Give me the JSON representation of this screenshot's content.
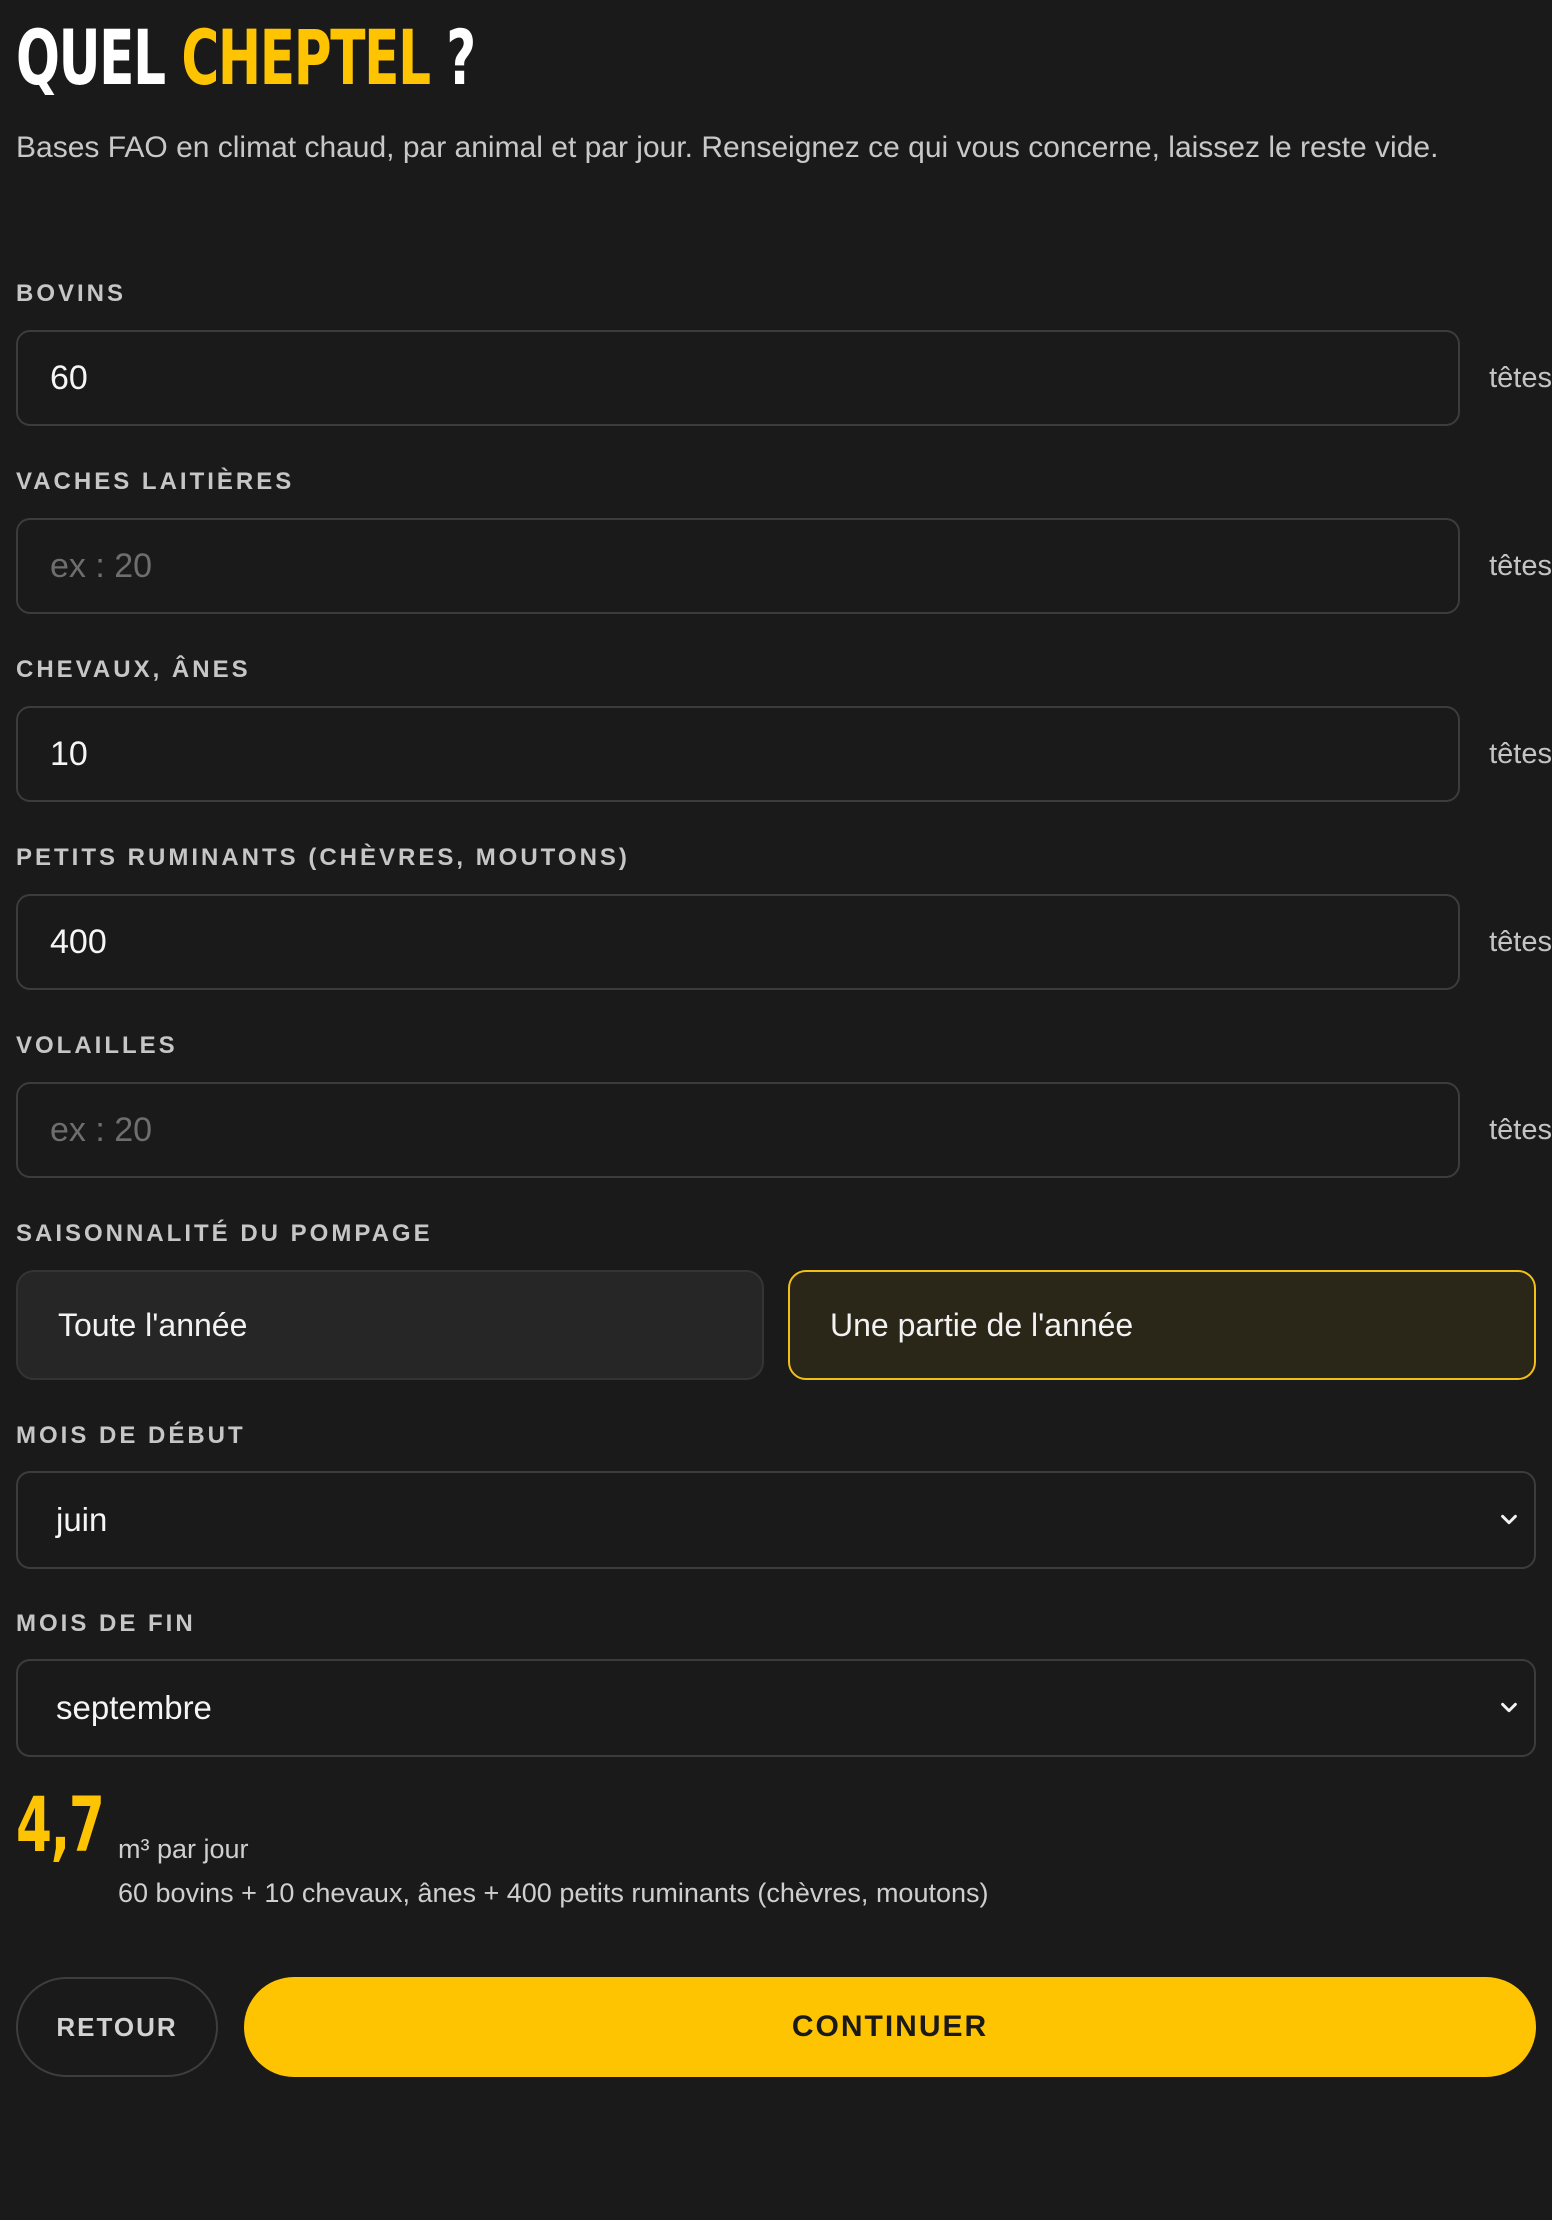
{
  "header": {
    "title_part1": "QUEL ",
    "title_accent": "CHEPTEL",
    "title_part2": " ?",
    "intro": "Bases FAO en climat chaud, par animal et par jour. Renseignez ce qui vous concerne, laissez le reste vide."
  },
  "fields": [
    {
      "label": "BOVINS",
      "value": "60",
      "placeholder": "ex : 20",
      "unit": "têtes"
    },
    {
      "label": "VACHES LAITIÈRES",
      "value": "",
      "placeholder": "ex : 20",
      "unit": "têtes"
    },
    {
      "label": "CHEVAUX, ÂNES",
      "value": "10",
      "placeholder": "ex : 20",
      "unit": "têtes"
    },
    {
      "label": "PETITS RUMINANTS (CHÈVRES, MOUTONS)",
      "value": "400",
      "placeholder": "ex : 20",
      "unit": "têtes"
    },
    {
      "label": "VOLAILLES",
      "value": "",
      "placeholder": "ex : 20",
      "unit": "têtes"
    }
  ],
  "season": {
    "label": "SAISONNALITÉ DU POMPAGE",
    "options": [
      "Toute l'année",
      "Une partie de l'année"
    ],
    "selected": "Une partie de l'année"
  },
  "start_month": {
    "label": "MOIS DE DÉBUT",
    "value": "juin"
  },
  "end_month": {
    "label": "MOIS DE FIN",
    "value": "septembre"
  },
  "result": {
    "value": "4,7",
    "unit": "m³ par jour",
    "detail": "60 bovins + 10 chevaux, ânes + 400 petits ruminants (chèvres, moutons)"
  },
  "actions": {
    "back": "RETOUR",
    "continue": "CONTINUER"
  },
  "colors": {
    "background": "#1a1a1a",
    "accent": "#fec301"
  }
}
